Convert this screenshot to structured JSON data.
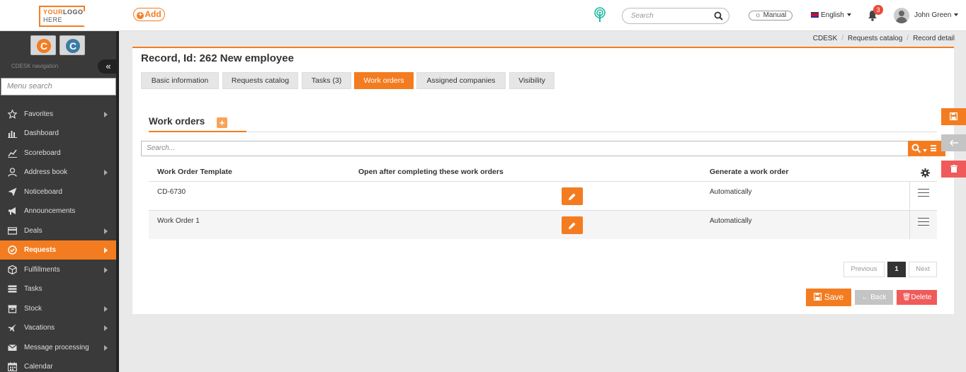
{
  "header": {
    "logo_line1": "YOUR",
    "logo_line1b": "LOGO",
    "logo_line2": "HERE",
    "add_label": "Add",
    "search_placeholder": "Search",
    "manual_label": "Manual",
    "language": "English",
    "notifications_count": "3",
    "user_name": "John Green"
  },
  "sidebar": {
    "nav_label": "CDESK navigation",
    "menu_search_placeholder": "Menu search",
    "items": [
      {
        "label": "Favorites",
        "icon": "star-icon",
        "submenu": true
      },
      {
        "label": "Dashboard",
        "icon": "bar-chart-icon",
        "submenu": false
      },
      {
        "label": "Scoreboard",
        "icon": "line-chart-icon",
        "submenu": false
      },
      {
        "label": "Address book",
        "icon": "user-icon",
        "submenu": true
      },
      {
        "label": "Noticeboard",
        "icon": "send-icon",
        "submenu": false
      },
      {
        "label": "Announcements",
        "icon": "megaphone-icon",
        "submenu": false
      },
      {
        "label": "Deals",
        "icon": "card-icon",
        "submenu": true
      },
      {
        "label": "Requests",
        "icon": "check-circle-icon",
        "submenu": true,
        "active": true
      },
      {
        "label": "Fulfillments",
        "icon": "cube-icon",
        "submenu": true
      },
      {
        "label": "Tasks",
        "icon": "list-icon",
        "submenu": false
      },
      {
        "label": "Stock",
        "icon": "box-icon",
        "submenu": true
      },
      {
        "label": "Vacations",
        "icon": "plane-icon",
        "submenu": true
      },
      {
        "label": "Message processing",
        "icon": "envelope-icon",
        "submenu": true
      },
      {
        "label": "Calendar",
        "icon": "calendar-icon",
        "submenu": false
      }
    ]
  },
  "breadcrumb": [
    "CDESK",
    "Requests catalog",
    "Record detail"
  ],
  "record": {
    "title": "Record, Id: 262 New employee",
    "tabs": [
      {
        "label": "Basic information"
      },
      {
        "label": "Requests catalog"
      },
      {
        "label": "Tasks (3)"
      },
      {
        "label": "Work orders",
        "active": true
      },
      {
        "label": "Assigned companies"
      },
      {
        "label": "Visibility"
      }
    ]
  },
  "work_orders": {
    "section_title": "Work orders",
    "search_placeholder": "Search...",
    "columns": [
      "Work Order Template",
      "Open after completing these work orders",
      "Generate a work order"
    ],
    "rows": [
      {
        "template": "CD-6730",
        "open_after": "",
        "generate": "Automatically"
      },
      {
        "template": "Work Order 1",
        "open_after": "",
        "generate": "Automatically"
      }
    ]
  },
  "pagination": {
    "previous": "Previous",
    "current_page": "1",
    "next": "Next"
  },
  "actions": {
    "save": "Save",
    "back": "Back",
    "delete": "Delete"
  },
  "colors": {
    "accent": "#f47c20",
    "sidebar_bg": "#3a3a3a",
    "delete": "#f05a5a"
  }
}
